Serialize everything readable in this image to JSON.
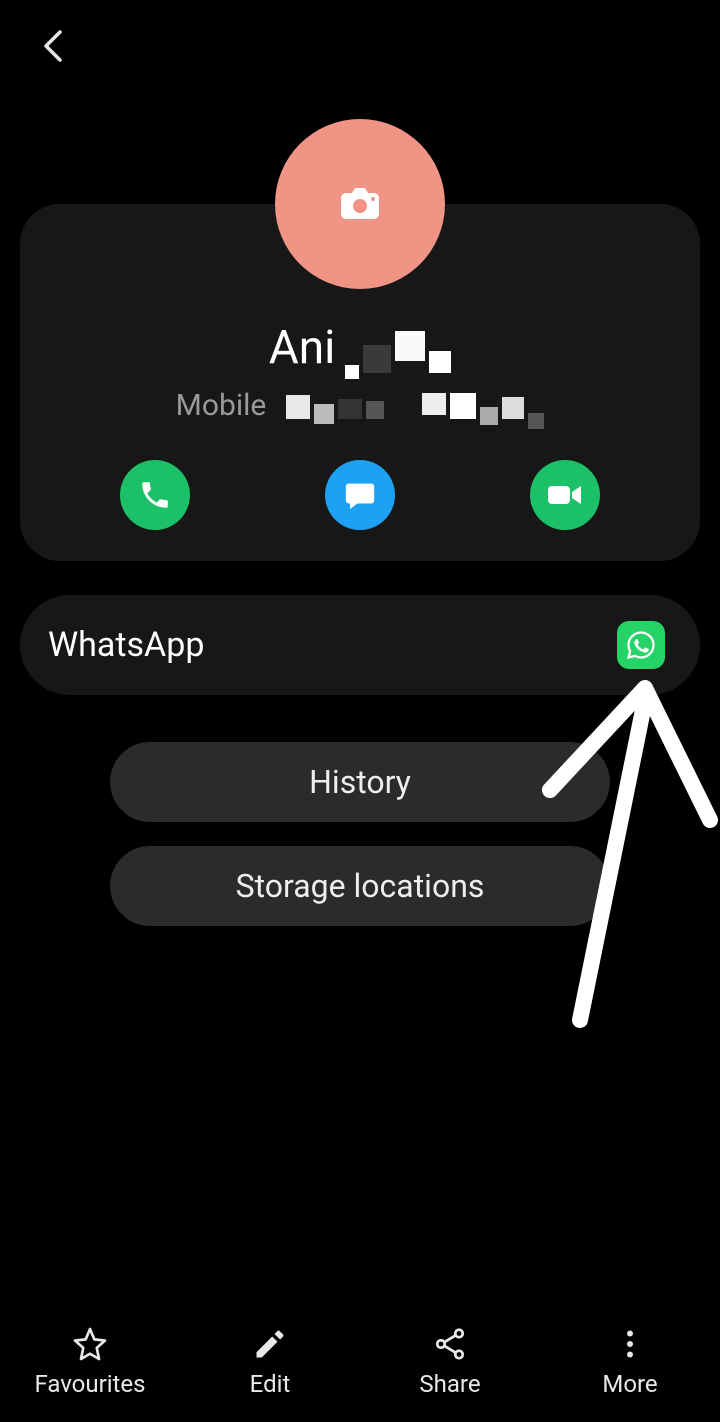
{
  "contact": {
    "name": "Ani",
    "phone_label": "Mobile"
  },
  "linked_apps": {
    "whatsapp_label": "WhatsApp"
  },
  "buttons": {
    "history": "History",
    "storage": "Storage locations"
  },
  "nav": {
    "favourites": "Favourites",
    "edit": "Edit",
    "share": "Share",
    "more": "More"
  },
  "colors": {
    "avatar": "#f09585",
    "call": "#1cc067",
    "message": "#1da1f2",
    "video": "#1cc067",
    "whatsapp": "#25d366"
  }
}
